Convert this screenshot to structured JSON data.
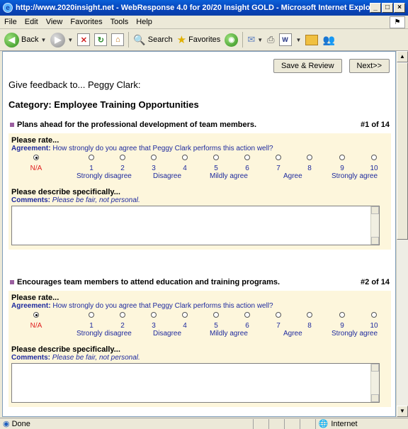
{
  "window": {
    "title": "http://www.2020insight.net - WebResponse 4.0 for 20/20 Insight GOLD - Microsoft Internet Explorer"
  },
  "menu": [
    "File",
    "Edit",
    "View",
    "Favorites",
    "Tools",
    "Help"
  ],
  "toolbar": {
    "back": "Back",
    "search": "Search",
    "favorites": "Favorites"
  },
  "page": {
    "save_label": "Save & Review",
    "next_label": "Next>>",
    "heading": "Give feedback to... Peggy Clark:",
    "category": "Category: Employee Training Opportunities"
  },
  "items": [
    {
      "title": "Plans ahead for the professional development of team members.",
      "number": "#1 of 14",
      "rate_label": "Please rate...",
      "agreement_label": "Agreement:",
      "agreement_text": "How strongly do you agree that Peggy Clark performs this action well?",
      "describe_label": "Please describe specifically...",
      "comments_label": "Comments:",
      "comments_hint": "Please be fair, not personal.",
      "comment_value": ""
    },
    {
      "title": "Encourages team members to attend education and training programs.",
      "number": "#2 of 14",
      "rate_label": "Please rate...",
      "agreement_label": "Agreement:",
      "agreement_text": "How strongly do you agree that Peggy Clark performs this action well?",
      "describe_label": "Please describe specifically...",
      "comments_label": "Comments:",
      "comments_hint": "Please be fair, not personal.",
      "comment_value": ""
    }
  ],
  "scale": {
    "options": [
      "N/A",
      "1",
      "2",
      "3",
      "4",
      "5",
      "6",
      "7",
      "8",
      "9",
      "10"
    ],
    "selected": "N/A",
    "labels": [
      "Strongly disagree",
      "Disagree",
      "Mildly agree",
      "Agree",
      "Strongly agree"
    ]
  },
  "status": {
    "left": "Done",
    "zone": "Internet"
  }
}
